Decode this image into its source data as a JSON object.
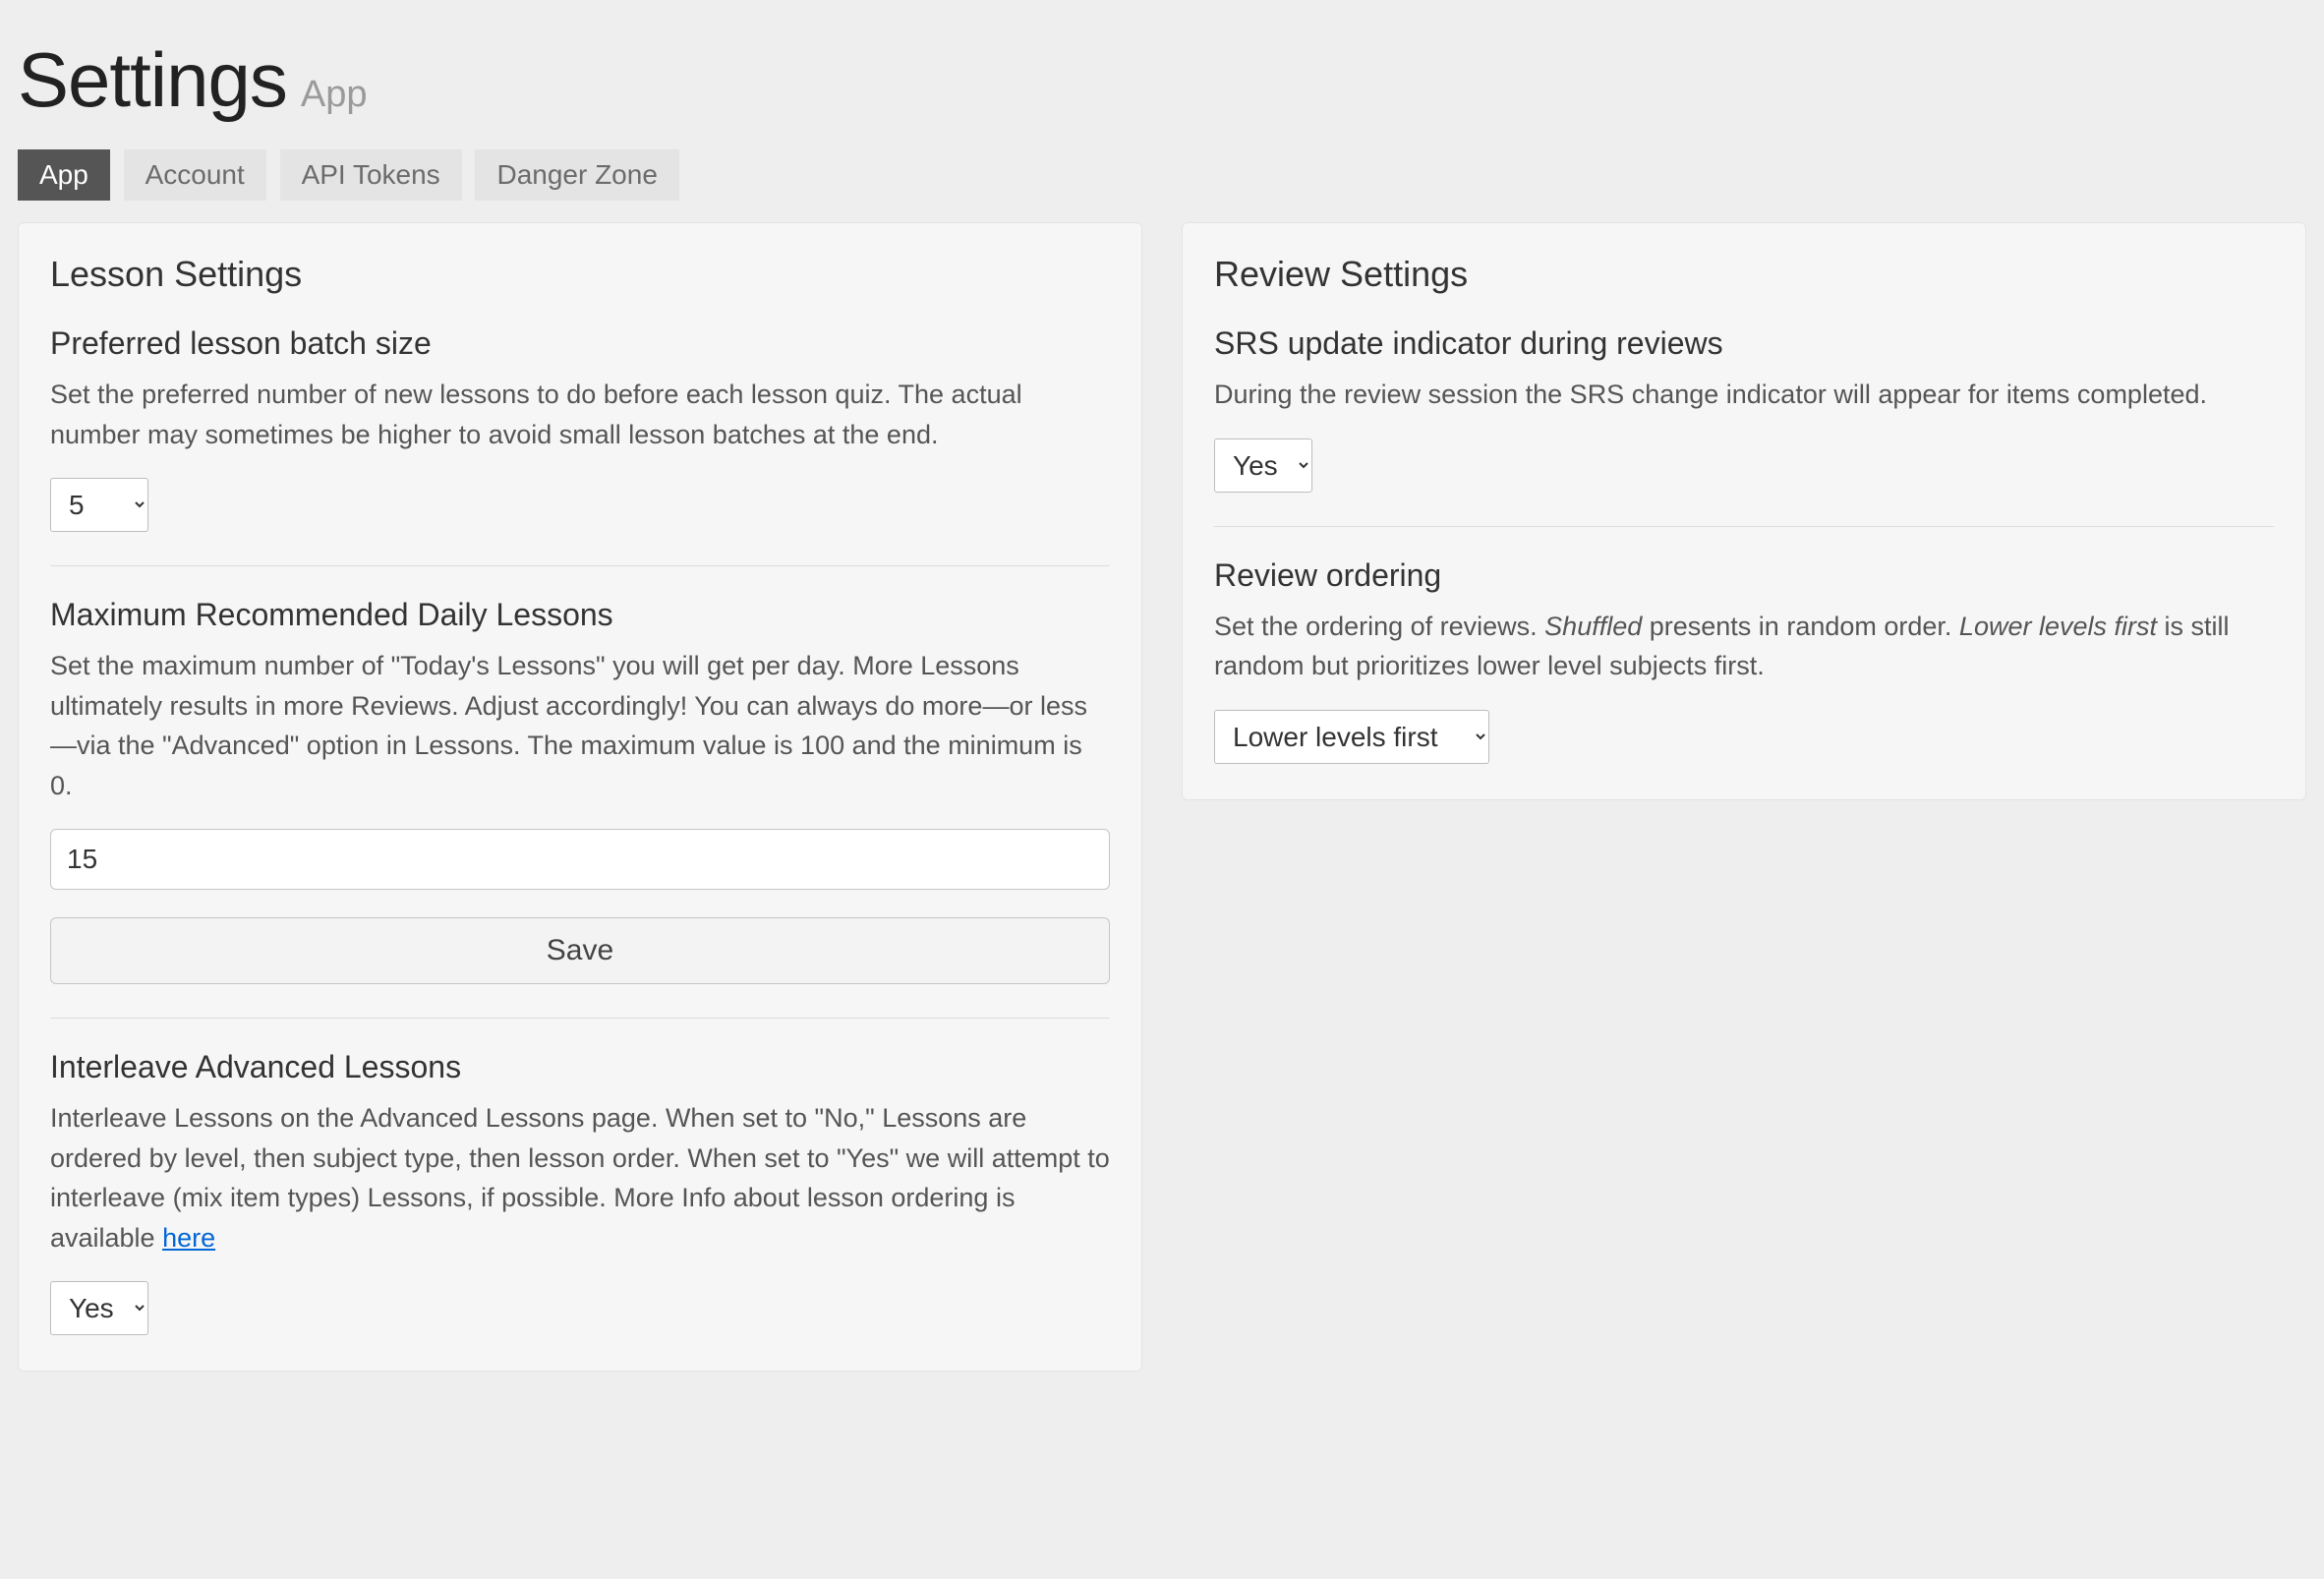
{
  "header": {
    "title": "Settings",
    "subtitle": "App"
  },
  "tabs": {
    "app": "App",
    "account": "Account",
    "api_tokens": "API Tokens",
    "danger_zone": "Danger Zone"
  },
  "lesson_panel": {
    "title": "Lesson Settings",
    "batch_size": {
      "title": "Preferred lesson batch size",
      "desc": "Set the preferred number of new lessons to do before each lesson quiz. The actual number may sometimes be higher to avoid small lesson batches at the end.",
      "value": "5"
    },
    "max_daily": {
      "title": "Maximum Recommended Daily Lessons",
      "desc": "Set the maximum number of \"Today's Lessons\" you will get per day. More Lessons ultimately results in more Reviews. Adjust accordingly! You can always do more—or less—via the \"Advanced\" option in Lessons. The maximum value is 100 and the minimum is 0.",
      "value": "15",
      "button": "Save"
    },
    "interleave": {
      "title": "Interleave Advanced Lessons",
      "desc_prefix": "Interleave Lessons on the Advanced Lessons page. When set to \"No,\" Lessons are ordered by level, then subject type, then lesson order. When set to \"Yes\" we will attempt to interleave (mix item types) Lessons, if possible. More Info about lesson ordering is available ",
      "link_text": "here",
      "value": "Yes"
    }
  },
  "review_panel": {
    "title": "Review Settings",
    "srs_indicator": {
      "title": "SRS update indicator during reviews",
      "desc": "During the review session the SRS change indicator will appear for items completed.",
      "value": "Yes"
    },
    "ordering": {
      "title": "Review ordering",
      "desc_prefix": "Set the ordering of reviews. ",
      "emph1": "Shuffled",
      "desc_mid": " presents in random order. ",
      "emph2": "Lower levels first",
      "desc_suffix": " is still random but prioritizes lower level subjects first.",
      "value": "Lower levels first"
    }
  }
}
